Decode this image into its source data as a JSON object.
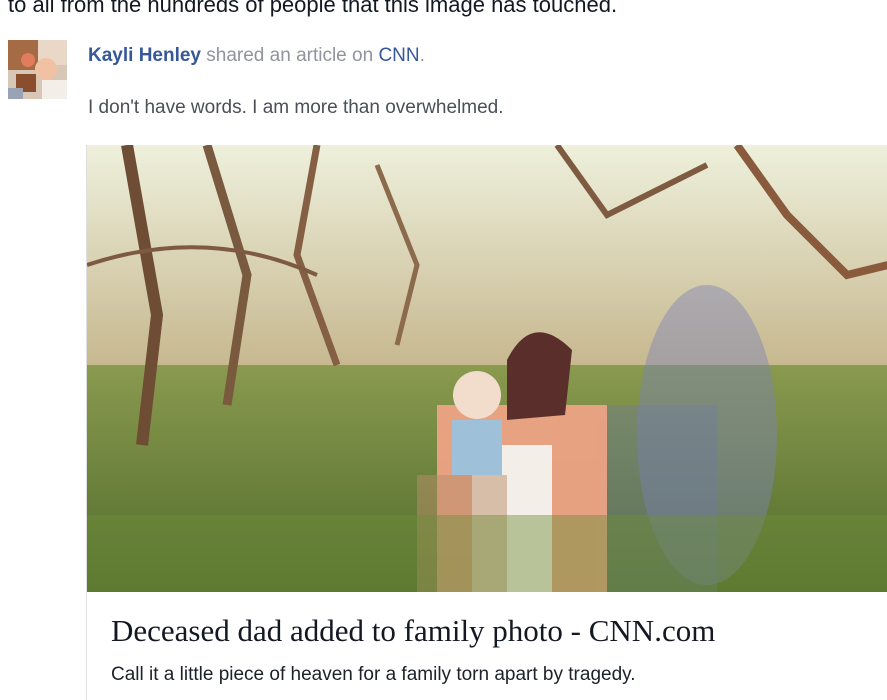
{
  "top_text": "to all from the hundreds of people that this image has touched.",
  "post": {
    "author": "Kayli Henley",
    "action": "shared an article on",
    "site": "CNN",
    "period": ".",
    "message": "I don't have words. I am more than overwhelmed."
  },
  "article": {
    "image_name": "family-photo-image",
    "title": "Deceased dad added to family photo - CNN.com",
    "description": "Call it a little piece of heaven for a family torn apart by tragedy."
  },
  "colors": {
    "link": "#365899",
    "meta_text": "#90949c",
    "body_text": "#4b4f56"
  }
}
